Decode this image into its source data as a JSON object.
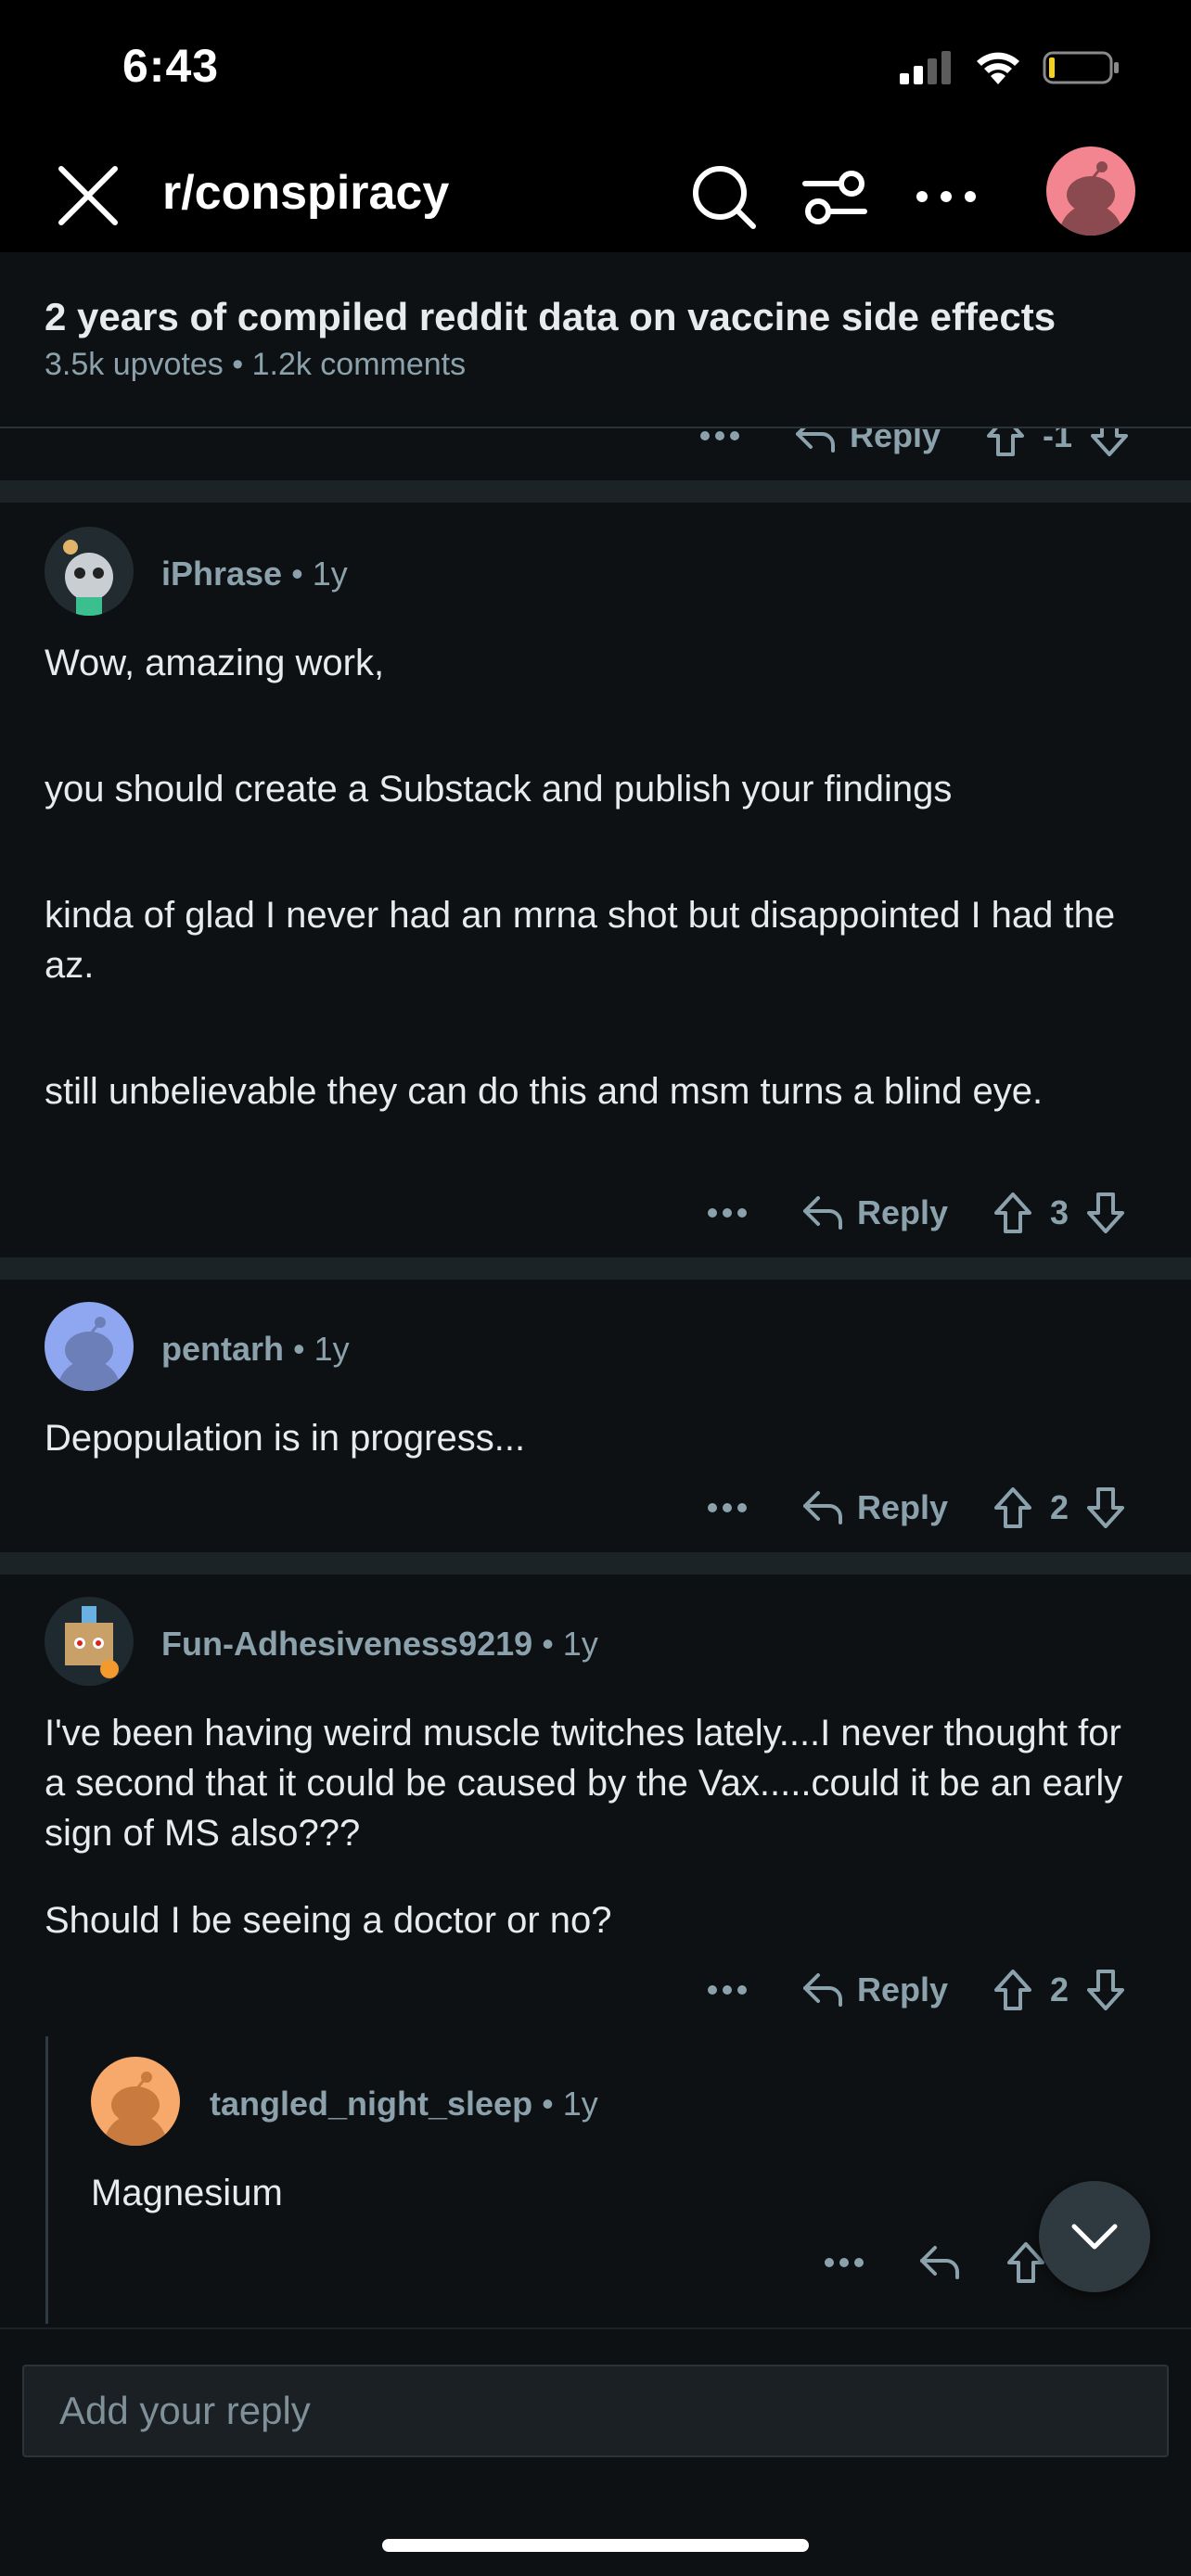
{
  "status_bar": {
    "time": "6:43"
  },
  "nav": {
    "subreddit": "r/conspiracy"
  },
  "post": {
    "title": "2 years of compiled reddit data on vaccine side effects",
    "meta": "3.5k upvotes • 1.2k comments"
  },
  "partial_comment": {
    "reply_label": "Reply",
    "score": "-1"
  },
  "comments": [
    {
      "username": "iPhrase",
      "age": "1y",
      "paragraphs": [
        "Wow, amazing work,",
        "you should create a Substack and publish your findings",
        "kinda of glad I never had an mrna shot but disappointed I had the az.",
        "still unbelievable they can do this and msm turns a blind eye."
      ],
      "reply_label": "Reply",
      "score": "3"
    },
    {
      "username": "pentarh",
      "age": "1y",
      "paragraphs": [
        "Depopulation is in progress..."
      ],
      "reply_label": "Reply",
      "score": "2"
    },
    {
      "username": "Fun-Adhesiveness9219",
      "age": "1y",
      "paragraphs": [
        "I've been having weird muscle twitches lately....I never thought for a second that it could be caused by the Vax.....could it be an early sign of MS also???",
        "Should I be seeing a doctor or no?"
      ],
      "reply_label": "Reply",
      "score": "2"
    },
    {
      "username": "tangled_night_sleep",
      "age": "1y",
      "paragraphs": [
        "Magnesium"
      ]
    }
  ],
  "reply_box": {
    "placeholder": "Add your reply"
  },
  "colors": {
    "background": "#000000",
    "card": "#0e1113",
    "separator": "#1c2327",
    "muted_text": "#8ba2ad",
    "primary_text": "#e8eaed",
    "avatar_pink": "#f2858f",
    "avatar_blue": "#8fa6f0",
    "avatar_orange": "#f7a86b"
  },
  "icons": [
    "close-icon",
    "search-icon",
    "filter-icon",
    "more-icon",
    "reply-icon",
    "upvote-icon",
    "downvote-icon",
    "chevron-down-icon",
    "signal-icon",
    "wifi-icon",
    "battery-icon"
  ]
}
